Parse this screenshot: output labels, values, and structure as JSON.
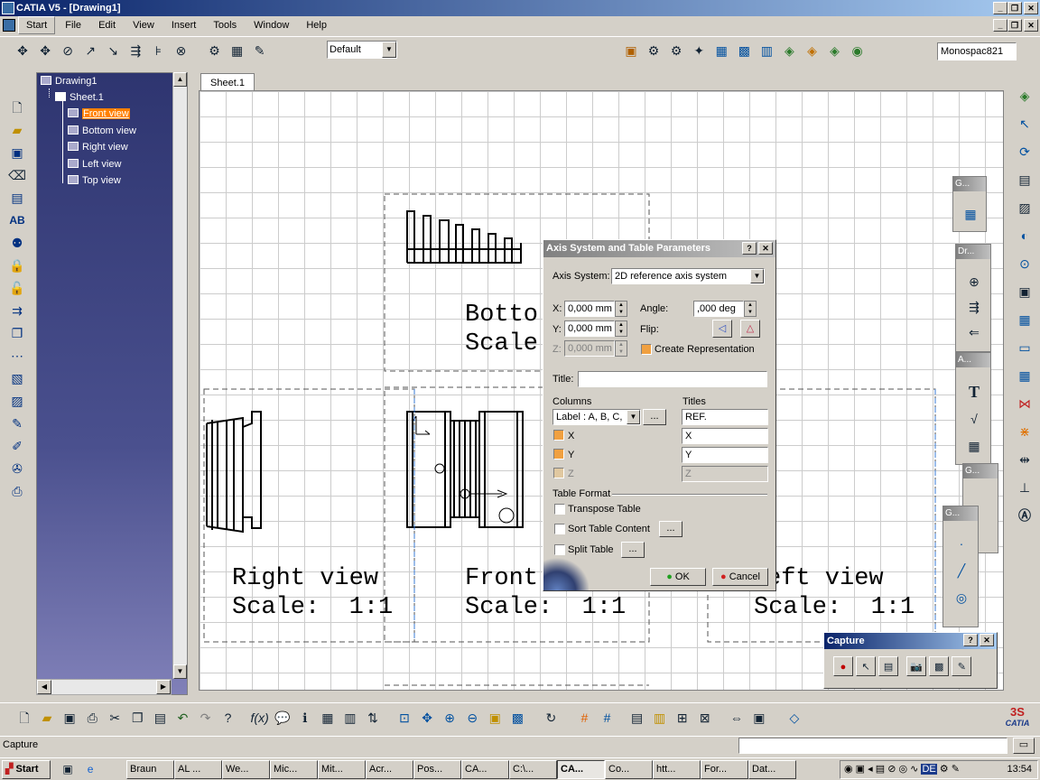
{
  "window": {
    "title": "CATIA V5 - [Drawing1]"
  },
  "menu": [
    "Start",
    "File",
    "Edit",
    "View",
    "Insert",
    "Tools",
    "Window",
    "Help"
  ],
  "toolbar": {
    "style_select": "Default",
    "font_select": "Monospac821"
  },
  "tree": {
    "root": "Drawing1",
    "sheet": "Sheet.1",
    "views": [
      "Front view",
      "Bottom view",
      "Right view",
      "Left view",
      "Top view"
    ],
    "selected": "Front view"
  },
  "sheet_tab": "Sheet.1",
  "views": {
    "bottom": {
      "name": "Botto",
      "scale": "Scale"
    },
    "right": {
      "name": "Right view",
      "scale": "Scale:  1:1"
    },
    "front": {
      "name": "Front",
      "scale": "Scale:  1:1"
    },
    "left": {
      "name": "eft view",
      "scale": "Scale:  1:1"
    }
  },
  "dialog": {
    "title": "Axis System and Table Parameters",
    "axis_system_label": "Axis System:",
    "axis_system_value": "2D reference axis system",
    "x_label": "X:",
    "x_value": "0,000 mm",
    "y_label": "Y:",
    "y_value": "0,000 mm",
    "z_label": "Z:",
    "z_value": "0,000 mm",
    "angle_label": "Angle:",
    "angle_value": ",000 deg",
    "flip_label": "Flip:",
    "create_rep": "Create Representation",
    "title_label": "Title:",
    "columns_label": "Columns",
    "titles_label": "Titles",
    "columns_select": "Label : A, B, C,",
    "ellipsis": "...",
    "ref_title": "REF.",
    "col_x": "X",
    "col_y": "Y",
    "col_z": "Z",
    "title_x": "X",
    "title_y": "Y",
    "title_z": "Z",
    "table_format": "Table Format",
    "transpose": "Transpose Table",
    "sort": "Sort Table Content",
    "split": "Split Table",
    "ok": "OK",
    "cancel": "Cancel"
  },
  "panels": {
    "g1": "G...",
    "dr": "Dr...",
    "a": "A...",
    "g2": "G...",
    "g3": "G..."
  },
  "capture": {
    "title": "Capture"
  },
  "status": "Capture",
  "taskbar": {
    "start": "Start",
    "tasks": [
      "Braun",
      "AL ...",
      "We...",
      "Mic...",
      "Mit...",
      "Acr...",
      "Pos...",
      "CA...",
      "C:\\...",
      "CA...",
      "Co...",
      "htt...",
      "For...",
      "Dat..."
    ],
    "active_index": 9,
    "clock": "13:54",
    "lang": "DE"
  },
  "logo": "CATIA"
}
